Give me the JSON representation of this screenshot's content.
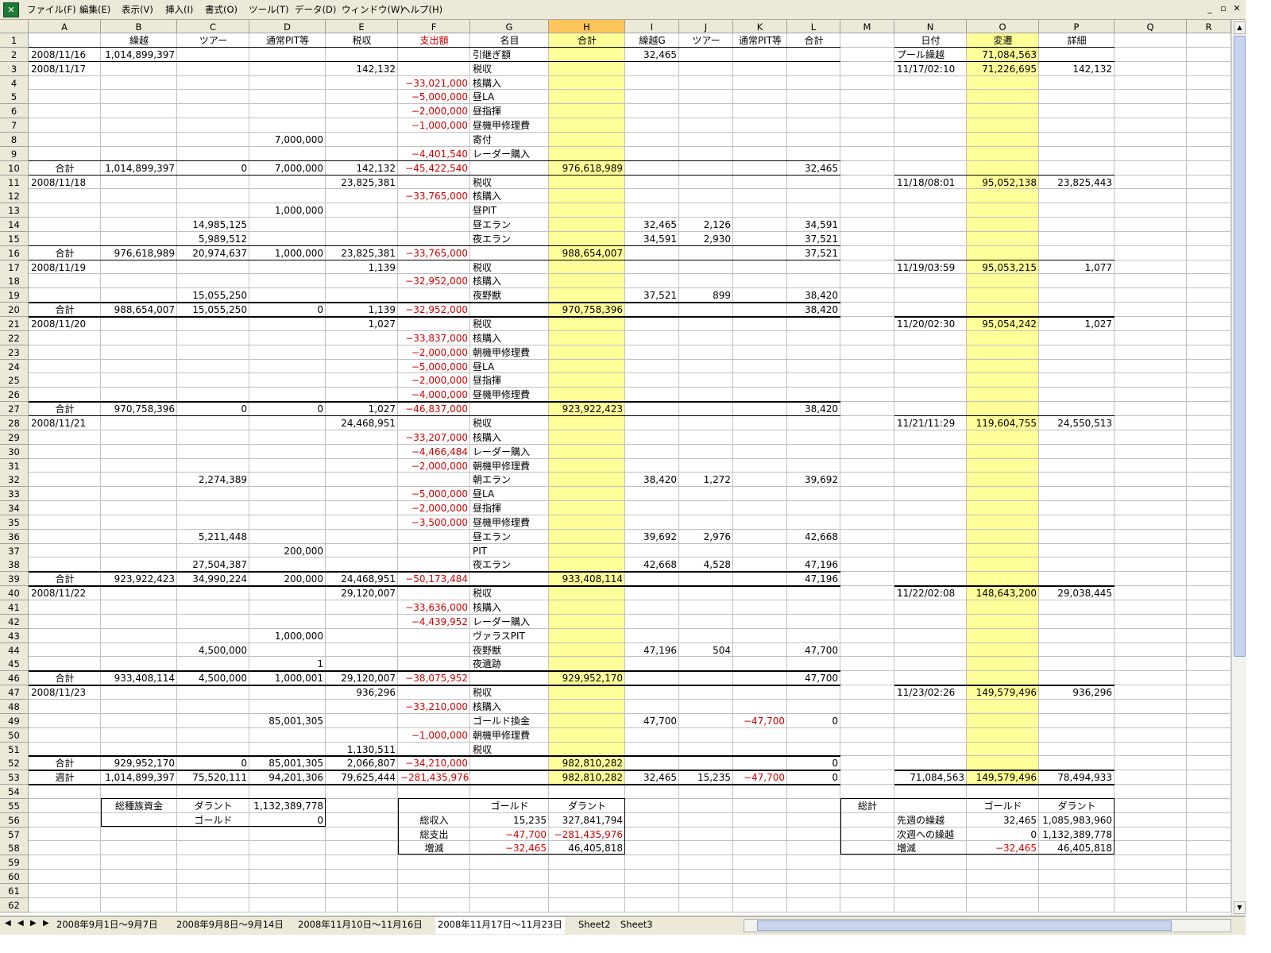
{
  "menu": [
    "ファイル(F)",
    "編集(E)",
    "表示(V)",
    "挿入(I)",
    "書式(O)",
    "ツール(T)",
    "データ(D)",
    "ウィンドウ(W)",
    "ヘルプ(H)"
  ],
  "window_buttons": [
    "_",
    "ਰ",
    "✕"
  ],
  "app_icon": "excel-icon",
  "columns": [
    "A",
    "B",
    "C",
    "D",
    "E",
    "F",
    "G",
    "H",
    "I",
    "J",
    "K",
    "L",
    "M",
    "N",
    "O",
    "P",
    "Q",
    "R"
  ],
  "selected_column": "H",
  "highlight_color": "#ffff99",
  "negative_color": "#d40000",
  "rows": [
    {
      "r": 1,
      "c": {
        "B": "繰越",
        "C": "ツアー",
        "D": "通常PIT等",
        "E": "税収",
        "F": "支出額",
        "G": "名目",
        "H": "合計",
        "I": "繰越G",
        "J": "ツアー",
        "K": "通常PIT等",
        "L": "合計",
        "N": "日付",
        "O": "変遷",
        "P": "詳細"
      }
    },
    {
      "r": 2,
      "c": {
        "A": "2008/11/16",
        "B": "1,014,899,397",
        "G": "引継ぎ額",
        "I": "32,465",
        "N": "プール繰越",
        "O": "71,084,563"
      }
    },
    {
      "r": 3,
      "c": {
        "A": "2008/11/17",
        "E": "142,132",
        "G": "税収",
        "N": "11/17/02:10",
        "O": "71,226,695",
        "P": "142,132"
      }
    },
    {
      "r": 4,
      "c": {
        "F": "-33,021,000",
        "G": "核購入"
      }
    },
    {
      "r": 5,
      "c": {
        "F": "-5,000,000",
        "G": "昼LA"
      }
    },
    {
      "r": 6,
      "c": {
        "F": "-2,000,000",
        "G": "昼指揮"
      }
    },
    {
      "r": 7,
      "c": {
        "F": "-1,000,000",
        "G": "昼機甲修理費"
      }
    },
    {
      "r": 8,
      "c": {
        "D": "7,000,000",
        "G": "寄付"
      }
    },
    {
      "r": 9,
      "c": {
        "F": "-4,401,540",
        "G": "レーダー購入"
      }
    },
    {
      "r": 10,
      "c": {
        "A": "合計",
        "B": "1,014,899,397",
        "C": "0",
        "D": "7,000,000",
        "E": "142,132",
        "F": "-45,422,540",
        "H": "976,618,989",
        "L": "32,465"
      }
    },
    {
      "r": 11,
      "c": {
        "A": "2008/11/18",
        "E": "23,825,381",
        "G": "税収",
        "N": "11/18/08:01",
        "O": "95,052,138",
        "P": "23,825,443"
      }
    },
    {
      "r": 12,
      "c": {
        "F": "-33,765,000",
        "G": "核購入"
      }
    },
    {
      "r": 13,
      "c": {
        "D": "1,000,000",
        "G": "昼PIT"
      }
    },
    {
      "r": 14,
      "c": {
        "C": "14,985,125",
        "G": "昼エラン",
        "I": "32,465",
        "J": "2,126",
        "L": "34,591"
      }
    },
    {
      "r": 15,
      "c": {
        "C": "5,989,512",
        "G": "夜エラン",
        "I": "34,591",
        "J": "2,930",
        "L": "37,521"
      }
    },
    {
      "r": 16,
      "c": {
        "A": "合計",
        "B": "976,618,989",
        "C": "20,974,637",
        "D": "1,000,000",
        "E": "23,825,381",
        "F": "-33,765,000",
        "H": "988,654,007",
        "L": "37,521"
      }
    },
    {
      "r": 17,
      "c": {
        "A": "2008/11/19",
        "E": "1,139",
        "G": "税収",
        "N": "11/19/03:59",
        "O": "95,053,215",
        "P": "1,077"
      }
    },
    {
      "r": 18,
      "c": {
        "F": "-32,952,000",
        "G": "核購入"
      }
    },
    {
      "r": 19,
      "c": {
        "C": "15,055,250",
        "G": "夜野獣",
        "I": "37,521",
        "J": "899",
        "L": "38,420"
      }
    },
    {
      "r": 20,
      "c": {
        "A": "合計",
        "B": "988,654,007",
        "C": "15,055,250",
        "D": "0",
        "E": "1,139",
        "F": "-32,952,000",
        "H": "970,758,396",
        "L": "38,420"
      }
    },
    {
      "r": 21,
      "c": {
        "A": "2008/11/20",
        "E": "1,027",
        "G": "税収",
        "N": "11/20/02:30",
        "O": "95,054,242",
        "P": "1,027"
      }
    },
    {
      "r": 22,
      "c": {
        "F": "-33,837,000",
        "G": "核購入"
      }
    },
    {
      "r": 23,
      "c": {
        "F": "-2,000,000",
        "G": "朝機甲修理費"
      }
    },
    {
      "r": 24,
      "c": {
        "F": "-5,000,000",
        "G": "昼LA"
      }
    },
    {
      "r": 25,
      "c": {
        "F": "-2,000,000",
        "G": "昼指揮"
      }
    },
    {
      "r": 26,
      "c": {
        "F": "-4,000,000",
        "G": "昼機甲修理費"
      }
    },
    {
      "r": 27,
      "c": {
        "A": "合計",
        "B": "970,758,396",
        "C": "0",
        "D": "0",
        "E": "1,027",
        "F": "-46,837,000",
        "H": "923,922,423",
        "L": "38,420"
      }
    },
    {
      "r": 28,
      "c": {
        "A": "2008/11/21",
        "E": "24,468,951",
        "G": "税収",
        "N": "11/21/11:29",
        "O": "119,604,755",
        "P": "24,550,513"
      }
    },
    {
      "r": 29,
      "c": {
        "F": "-33,207,000",
        "G": "核購入"
      }
    },
    {
      "r": 30,
      "c": {
        "F": "-4,466,484",
        "G": "レーダー購入"
      }
    },
    {
      "r": 31,
      "c": {
        "F": "-2,000,000",
        "G": "朝機甲修理費"
      }
    },
    {
      "r": 32,
      "c": {
        "C": "2,274,389",
        "G": "朝エラン",
        "I": "38,420",
        "J": "1,272",
        "L": "39,692"
      }
    },
    {
      "r": 33,
      "c": {
        "F": "-5,000,000",
        "G": "昼LA"
      }
    },
    {
      "r": 34,
      "c": {
        "F": "-2,000,000",
        "G": "昼指揮"
      }
    },
    {
      "r": 35,
      "c": {
        "F": "-3,500,000",
        "G": "昼機甲修理費"
      }
    },
    {
      "r": 36,
      "c": {
        "C": "5,211,448",
        "G": "昼エラン",
        "I": "39,692",
        "J": "2,976",
        "L": "42,668"
      }
    },
    {
      "r": 37,
      "c": {
        "D": "200,000",
        "G": "PIT"
      }
    },
    {
      "r": 38,
      "c": {
        "C": "27,504,387",
        "G": "夜エラン",
        "I": "42,668",
        "J": "4,528",
        "L": "47,196"
      }
    },
    {
      "r": 39,
      "c": {
        "A": "合計",
        "B": "923,922,423",
        "C": "34,990,224",
        "D": "200,000",
        "E": "24,468,951",
        "F": "-50,173,484",
        "H": "933,408,114",
        "L": "47,196"
      }
    },
    {
      "r": 40,
      "c": {
        "A": "2008/11/22",
        "E": "29,120,007",
        "G": "税収",
        "N": "11/22/02:08",
        "O": "148,643,200",
        "P": "29,038,445"
      }
    },
    {
      "r": 41,
      "c": {
        "F": "-33,636,000",
        "G": "核購入"
      }
    },
    {
      "r": 42,
      "c": {
        "F": "-4,439,952",
        "G": "レーダー購入"
      }
    },
    {
      "r": 43,
      "c": {
        "D": "1,000,000",
        "G": "ヴァラスPIT"
      }
    },
    {
      "r": 44,
      "c": {
        "C": "4,500,000",
        "G": "夜野獣",
        "I": "47,196",
        "J": "504",
        "L": "47,700"
      }
    },
    {
      "r": 45,
      "c": {
        "D": "1",
        "G": "夜遺跡"
      }
    },
    {
      "r": 46,
      "c": {
        "A": "合計",
        "B": "933,408,114",
        "C": "4,500,000",
        "D": "1,000,001",
        "E": "29,120,007",
        "F": "-38,075,952",
        "H": "929,952,170",
        "L": "47,700"
      }
    },
    {
      "r": 47,
      "c": {
        "A": "2008/11/23",
        "E": "936,296",
        "G": "税収",
        "N": "11/23/02:26",
        "O": "149,579,496",
        "P": "936,296"
      }
    },
    {
      "r": 48,
      "c": {
        "F": "-33,210,000",
        "G": "核購入"
      }
    },
    {
      "r": 49,
      "c": {
        "D": "85,001,305",
        "G": "ゴールド換金",
        "I": "47,700",
        "K": "-47,700",
        "L": "0"
      }
    },
    {
      "r": 50,
      "c": {
        "F": "-1,000,000",
        "G": "朝機甲修理費"
      }
    },
    {
      "r": 51,
      "c": {
        "E": "1,130,511",
        "G": "税収"
      }
    },
    {
      "r": 52,
      "c": {
        "A": "合計",
        "B": "929,952,170",
        "C": "0",
        "D": "85,001,305",
        "E": "2,066,807",
        "F": "-34,210,000",
        "H": "982,810,282",
        "L": "0"
      }
    },
    {
      "r": 53,
      "c": {
        "A": "週計",
        "B": "1,014,899,397",
        "C": "75,520,111",
        "D": "94,201,306",
        "E": "79,625,444",
        "F": "-281,435,976",
        "H": "982,810,282",
        "I": "32,465",
        "J": "15,235",
        "K": "-47,700",
        "L": "0",
        "N": "71,084,563",
        "O": "149,579,496",
        "P": "78,494,933"
      }
    },
    {
      "r": 54,
      "c": {}
    },
    {
      "r": 55,
      "c": {
        "B": "総種族資金",
        "C": "ダラント",
        "D": "1,132,389,778",
        "G": "ゴールド",
        "H": "ダラント",
        "M": "総計",
        "O": "ゴールド",
        "P": "ダラント"
      }
    },
    {
      "r": 56,
      "c": {
        "C": "ゴールド",
        "D": "0",
        "F": "総収入",
        "G": "15,235",
        "H": "327,841,794",
        "N": "先週の繰越",
        "O": "32,465",
        "P": "1,085,983,960"
      }
    },
    {
      "r": 57,
      "c": {
        "F": "総支出",
        "G": "-47,700",
        "H": "-281,435,976",
        "N": "次週への繰越",
        "O": "0",
        "P": "1,132,389,778"
      }
    },
    {
      "r": 58,
      "c": {
        "F": "増減",
        "G": "-32,465",
        "H": "46,405,818",
        "N": "増減",
        "O": "-32,465",
        "P": "46,405,818"
      }
    },
    {
      "r": 59,
      "c": {}
    },
    {
      "r": 60,
      "c": {}
    },
    {
      "r": 61,
      "c": {}
    },
    {
      "r": 62,
      "c": {}
    }
  ],
  "sheet_tabs": [
    "2008年9月1日～9月7日",
    "2008年9月8日～9月14日",
    "2008年11月10日～11月16日",
    "2008年11月17日～11月23日",
    "Sheet2",
    "Sheet3"
  ],
  "active_tab": "2008年11月17日～11月23日",
  "nav_buttons": [
    "first-sheet-icon",
    "prev-sheet-icon",
    "next-sheet-icon",
    "last-sheet-icon"
  ]
}
